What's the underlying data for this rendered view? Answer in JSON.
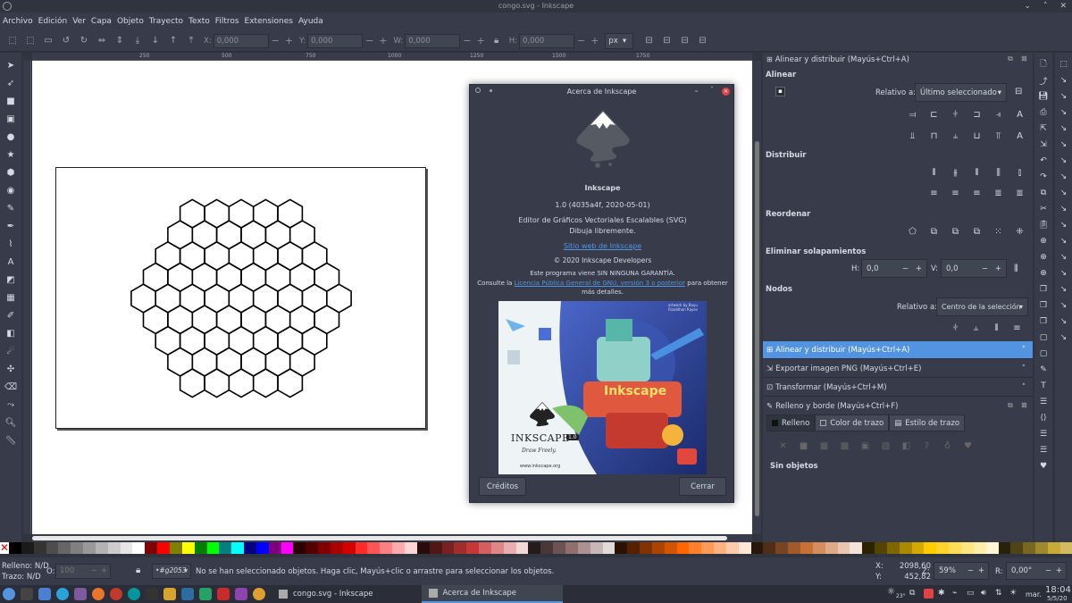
{
  "window": {
    "title": "congo.svg - Inkscape"
  },
  "menu": [
    "Archivo",
    "Edición",
    "Ver",
    "Capa",
    "Objeto",
    "Trayecto",
    "Texto",
    "Filtros",
    "Extensiones",
    "Ayuda"
  ],
  "toolbar": {
    "x_label": "X:",
    "x_value": "0,000",
    "y_label": "Y:",
    "y_value": "0,000",
    "w_label": "W:",
    "w_value": "0,000",
    "h_label": "H:",
    "h_value": "0,000",
    "unit": "px"
  },
  "ruler": {
    "labels": [
      "250",
      "500",
      "750",
      "1000",
      "1250",
      "1500",
      "1750"
    ]
  },
  "about": {
    "title": "Acerca de Inkscape",
    "app_name": "Inkscape",
    "version": "1.0 (4035a4f, 2020-05-01)",
    "description": "Editor de Gráficos Vectoriales Escalables (SVG)",
    "tagline": "Dibuja libremente.",
    "website": "Sitio web de Inkscape",
    "copyright": "© 2020 Inkscape Developers",
    "warranty": "Este programa viene SIN NINGUNA GARANTÍA.",
    "license_pre": "Consulte la",
    "license_link": "Licencia Pública General de GNU, versión 3 o posterior",
    "license_post": "para obtener",
    "license_more": "más detalles.",
    "splash_brand": "INKSCAPE",
    "splash_version": "1.0",
    "splash_tag": "Draw Freely.",
    "splash_url": "www.inkscape.org",
    "splash_artist": "artwork by Bayu Rizaldhan Rayes",
    "credits_button": "Créditos",
    "close_button": "Cerrar"
  },
  "align_panel": {
    "title": "Alinear y distribuir (Mayús+Ctrl+A)",
    "align_heading": "Alinear",
    "relative_label": "Relativo a:",
    "relative_value": "Último seleccionado",
    "distribute_heading": "Distribuir",
    "reorder_heading": "Reordenar",
    "overlap_heading": "Eliminar solapamientos",
    "h_label": "H:",
    "h_value": "0,0",
    "v_label": "V:",
    "v_value": "0,0",
    "nodes_heading": "Nodos",
    "nodes_relative_label": "Relativo a:",
    "nodes_relative_value": "Centro de la selección"
  },
  "docked": [
    "Alinear y distribuir (Mayús+Ctrl+A)",
    "Exportar imagen PNG (Mayús+Ctrl+E)",
    "Transformar (Mayús+Ctrl+M)"
  ],
  "fill_panel": {
    "title": "Relleno y borde (Mayús+Ctrl+F)",
    "tabs": [
      "Relleno",
      "Color de trazo",
      "Estilo de trazo"
    ],
    "empty": "Sin objetos"
  },
  "palette": [
    "#000000",
    "#1a1a1a",
    "#333333",
    "#4d4d4d",
    "#666666",
    "#808080",
    "#999999",
    "#b3b3b3",
    "#cccccc",
    "#e6e6e6",
    "#ffffff",
    "#800000",
    "#ff0000",
    "#808000",
    "#ffff00",
    "#008000",
    "#00ff00",
    "#008080",
    "#00ffff",
    "#000080",
    "#0000ff",
    "#800080",
    "#ff00ff",
    "#2b0000",
    "#550000",
    "#800000",
    "#aa0000",
    "#d40000",
    "#ff2a2a",
    "#ff5555",
    "#ff8080",
    "#ffaaaa",
    "#ffd5d5",
    "#280b0b",
    "#501616",
    "#782121",
    "#a02c2c",
    "#c83737",
    "#d35f5f",
    "#de8787",
    "#e9afaf",
    "#f4d7d7",
    "#241c1c",
    "#483737",
    "#6c5353",
    "#916f6f",
    "#ac9393",
    "#c8b7b7",
    "#e3dbdb",
    "#2b1100",
    "#552200",
    "#803300",
    "#aa4400",
    "#d45500",
    "#ff6600",
    "#ff7f2a",
    "#ff9955",
    "#ffb380",
    "#ffccaa",
    "#ffe6d5",
    "#28170b",
    "#502d16",
    "#784421",
    "#a05a2c",
    "#c87137",
    "#d38d5f",
    "#deaa87",
    "#e9c6af",
    "#f4e3d7",
    "#2b2200",
    "#554400",
    "#806600",
    "#aa8800",
    "#d4aa00",
    "#ffcc00",
    "#ffd42a",
    "#ffdd55",
    "#ffe680",
    "#ffeeaa",
    "#fff6d5",
    "#28220b",
    "#504416",
    "#786721",
    "#a0892c",
    "#c8ab37",
    "#d3bc5f"
  ],
  "status": {
    "fill_label": "Relleno:",
    "fill_value": "N/D",
    "stroke_label": "Trazo:",
    "stroke_value": "N/D",
    "opacity_label": "O:",
    "opacity_value": "100",
    "layer": "•#g2053",
    "message": "No se han seleccionado objetos. Haga clic, Mayús+clic o arrastre para seleccionar los objetos.",
    "x_label": "X:",
    "x_value": "2098,60",
    "y_label": "Y:",
    "y_value": "452,82",
    "zoom_label": "Z:",
    "zoom_value": "59%",
    "rot_label": "R:",
    "rot_value": "0,00°"
  },
  "taskbar": {
    "windows": [
      "congo.svg - Inkscape",
      "Acerca de Inkscape"
    ],
    "weather": "23°",
    "day": "mar.",
    "time": "18:04",
    "date": "5/5/20"
  }
}
